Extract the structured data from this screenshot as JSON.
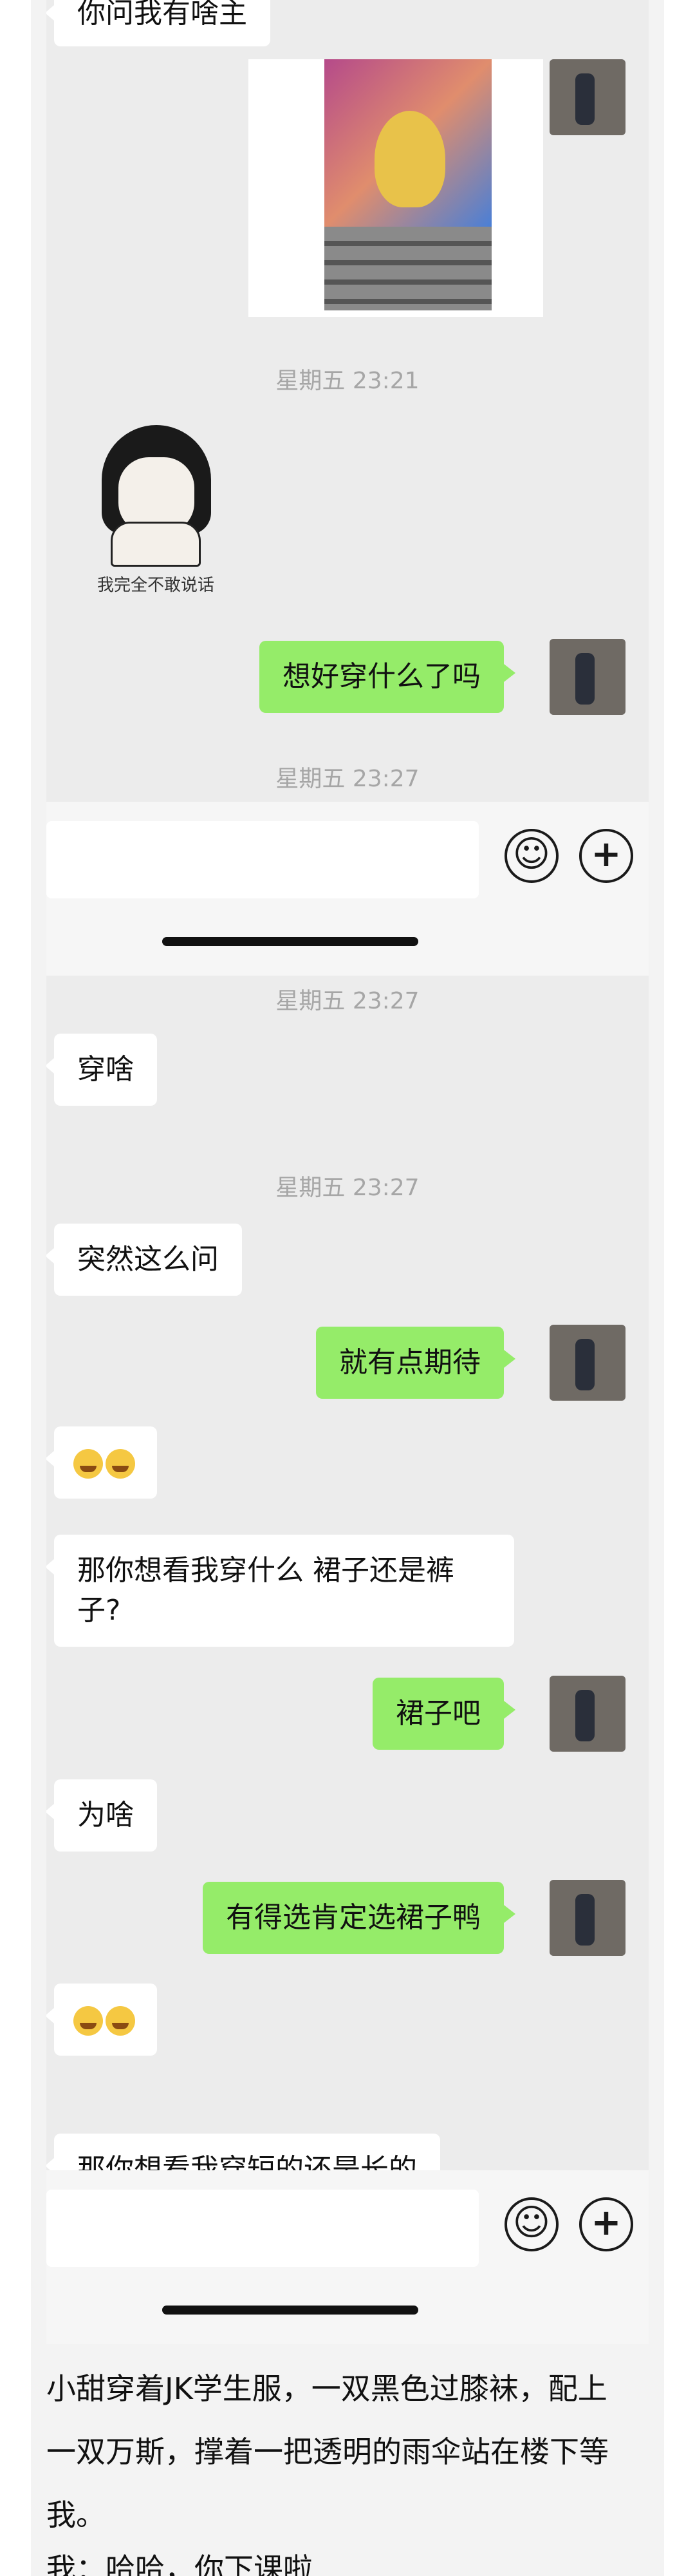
{
  "panel1": {
    "top_partial_text": "你问我有啥主",
    "timestamp1": "星期五 23:21",
    "sticker_caption": "我完全不敢说话",
    "message_out1": "想好穿什么了吗",
    "timestamp_partial": "星期五 23:27"
  },
  "panel2": {
    "timestamp1": "星期五 23:27",
    "msg1": "穿啥",
    "timestamp2": "星期五 23:27",
    "msg2": "突然这么问",
    "msg3_out": "就有点期待",
    "msg5_line1": "那你想看我穿什么 裙子还是裤",
    "msg5_line2": "子?",
    "msg6_out": "裙子吧",
    "msg7": "为啥",
    "msg8_out": "有得选肯定选裙子鸭",
    "msg10_partial": "那你想看我穿短的还是长的"
  },
  "input": {
    "emoji_icon": "☺",
    "plus_icon": "+"
  },
  "caption": {
    "line1": "小甜穿着JK学生服，一双黑色过膝袜，配上",
    "line2": "一双万斯，撑着一把透明的雨伞站在楼下等",
    "line3": "我。",
    "line4": "我：哈哈，你下课啦"
  }
}
